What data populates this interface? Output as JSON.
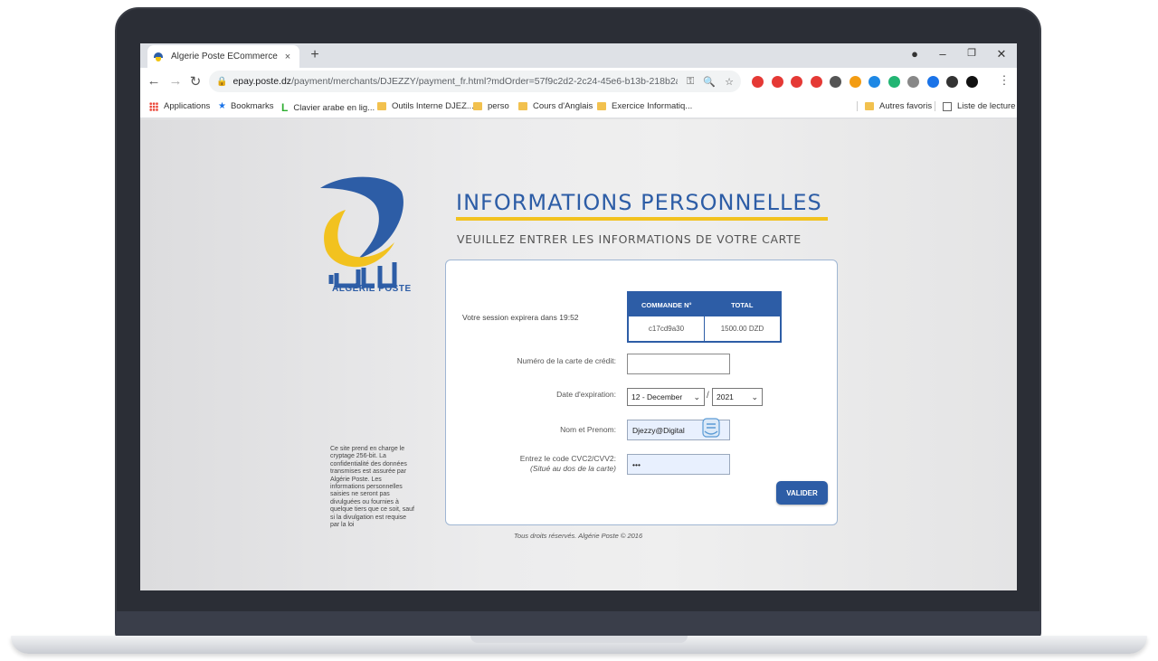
{
  "browser": {
    "tab_title": "Algerie Poste ECommerce",
    "tab_close": "×",
    "new_tab": "+",
    "window_controls": {
      "record": "●",
      "minimize": "–",
      "restore": "❐",
      "close": "✕"
    },
    "nav": {
      "back": "←",
      "forward": "→",
      "reload": "↻"
    },
    "url_host": "epay.poste.dz",
    "url_path": "/payment/merchants/DJEZZY/payment_fr.html?mdOrder=57f9c2d2-2c24-45e6-b13b-218b2a908...",
    "omnibox_icons": {
      "key": "⚿",
      "zoom": "🔍",
      "star": "☆"
    },
    "menu": "⋮",
    "extension_colors": [
      "#e53935",
      "#e53935",
      "#e53935",
      "#e53935",
      "#555555",
      "#f39c12",
      "#1e88e5",
      "#22b573",
      "#888888",
      "#1a73e8",
      "#333333",
      "#111111"
    ],
    "bookmarks": {
      "apps": "Applications",
      "bookmarks": "Bookmarks",
      "items": [
        "Clavier arabe en lig...",
        "Outils Interne DJEZ...",
        "perso",
        "Cours d'Anglais",
        "Exercice Informatiq..."
      ],
      "other": "Autres favoris",
      "reading_list": "Liste de lecture"
    }
  },
  "page": {
    "logo_text": "ALGÉRIE POSTE",
    "heading": "INFORMATIONS PERSONNELLES",
    "subheading": "VEUILLEZ ENTRER LES INFORMATIONS DE VOTRE CARTE",
    "session_text": "Votre session expirera dans 19:52",
    "order": {
      "col_order": "COMMANDE N°",
      "col_total": "TOTAL",
      "order_number": "c17cd9a30",
      "total": "1500.00 DZD"
    },
    "form": {
      "card_label": "Numéro de la carte de crédit:",
      "card_value": "",
      "expiry_label": "Date d'expiration:",
      "expiry_month": "12 - December",
      "expiry_separator": "/",
      "expiry_year": "2021",
      "name_label": "Nom et Prenom:",
      "name_value": "Djezzy@Digital",
      "cvc_label_1": "Entrez le code CVC2/CVV2:",
      "cvc_label_2": "(Situé au dos de la carte)",
      "cvc_value": "•••",
      "submit": "VALIDER"
    },
    "disclaimer": "Ce site prend en charge le cryptage 256-bit. La confidentialité des données transmises est assurée par Algérie Poste. Les informations personnelles saisies ne seront pas divulguées ou fournies à quelque tiers que ce soit, sauf si la divulgation est requise par la loi",
    "footer": "Tous droits réservés. Algérie Poste © 2016"
  }
}
